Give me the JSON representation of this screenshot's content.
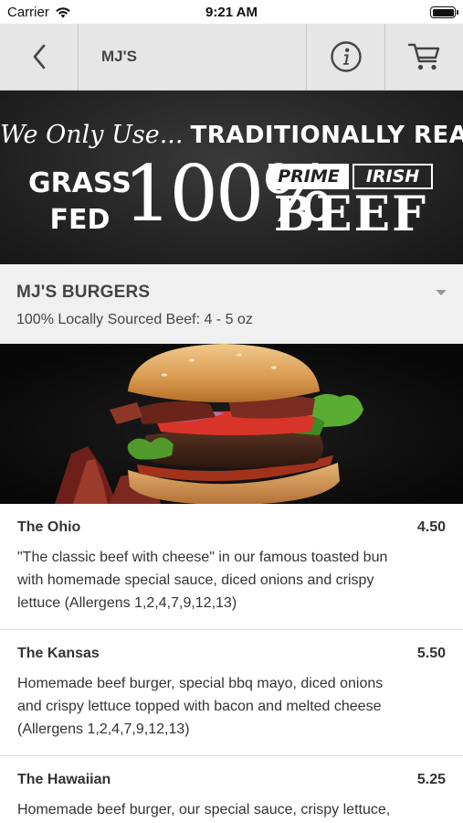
{
  "status_bar": {
    "carrier": "Carrier",
    "time": "9:21 AM"
  },
  "nav": {
    "title": "MJ'S",
    "icons": [
      "chevron-left-icon",
      "info-icon",
      "cart-icon"
    ]
  },
  "banner": {
    "line1_script": "We Only Use...",
    "line1_caps": "TRADITIONALLY REARED",
    "grass": "GRASS",
    "fed": "FED",
    "percent": "100%",
    "prime": "PRIME",
    "irish": "IRISH",
    "beef": "BEEF"
  },
  "category": {
    "title": "MJ'S BURGERS",
    "subtitle": "100% Locally Sourced Beef: 4 - 5 oz"
  },
  "items": [
    {
      "name": "The Ohio",
      "price": "4.50",
      "description": "\"The classic beef with cheese\" in our famous toasted bun with homemade special sauce, diced onions and crispy lettuce (Allergens 1,2,4,7,9,12,13)"
    },
    {
      "name": "The Kansas",
      "price": "5.50",
      "description": "Homemade beef burger, special bbq mayo, diced onions and crispy lettuce topped with bacon and melted cheese (Allergens 1,2,4,7,9,12,13)"
    },
    {
      "name": "The Hawaiian",
      "price": "5.25",
      "description": "Homemade beef burger, our special sauce, crispy lettuce, onions and slice of pineapple (Allergens"
    }
  ],
  "colors": {
    "nav_background": "#e6e6e6",
    "category_background": "#f0f0f0",
    "banner_background": "#262626",
    "text": "#333333"
  }
}
